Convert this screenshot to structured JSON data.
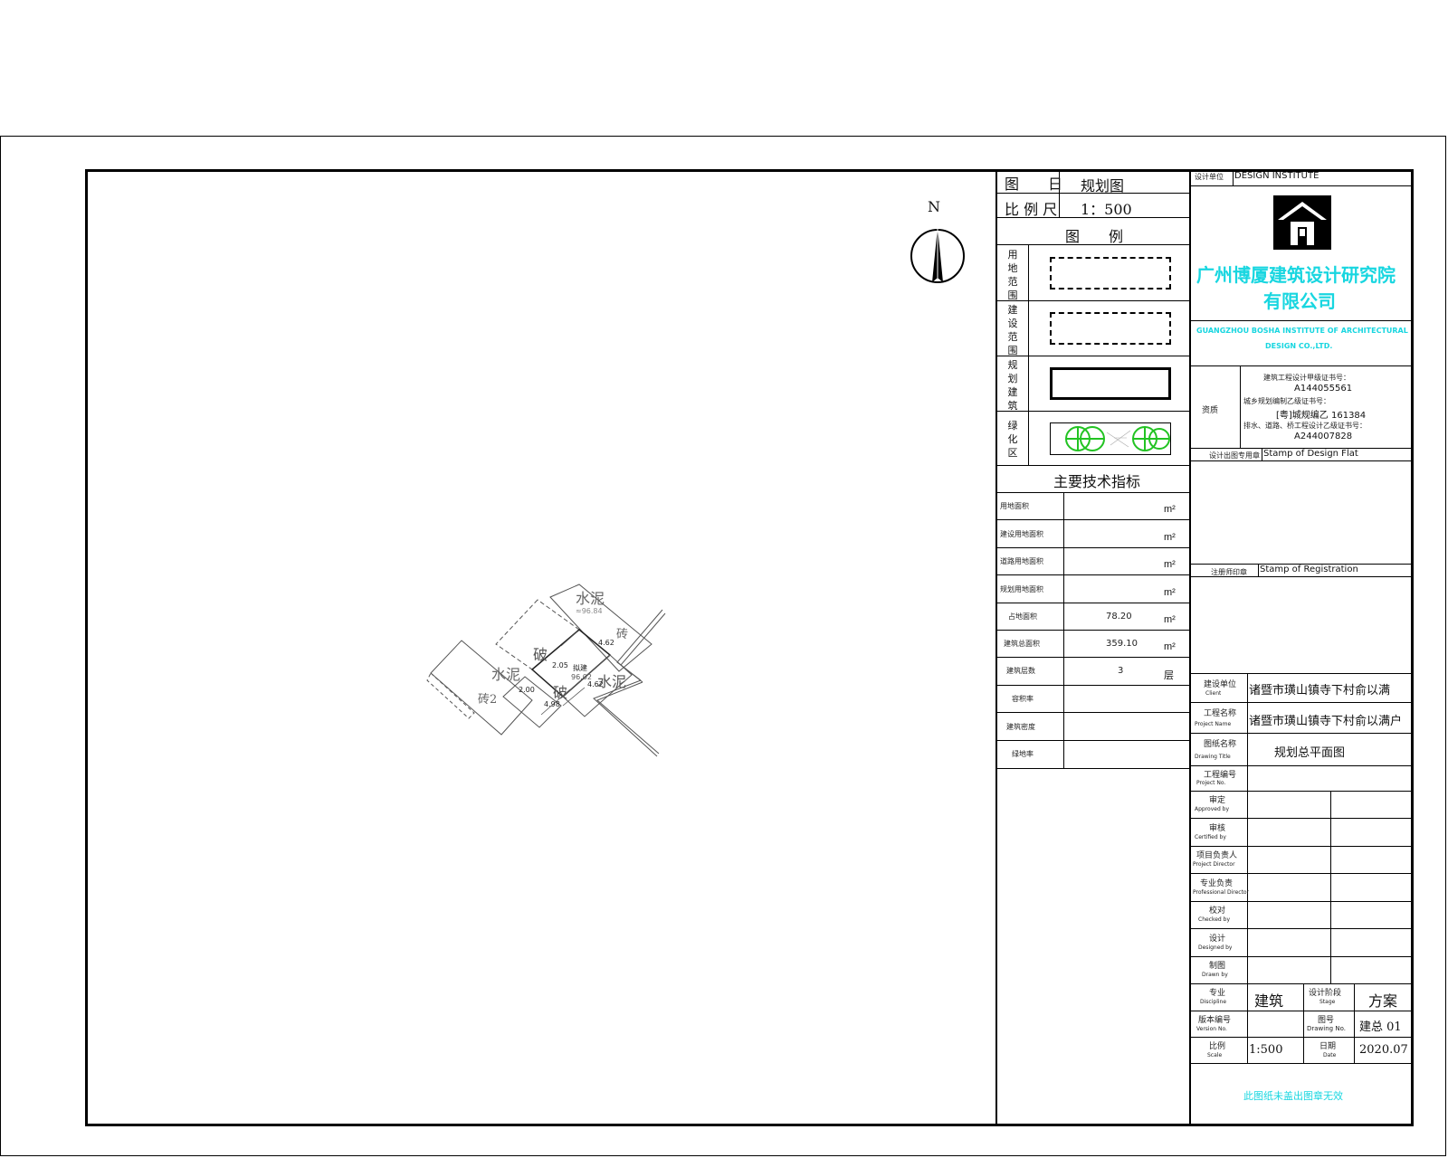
{
  "title_block": {
    "drawing_type_label": "图　　日",
    "drawing_type_value": "规划图",
    "scale_label": "比 例 尺",
    "scale_value": "1：500",
    "legend_title": "图　　例",
    "legend": [
      {
        "label": "用地范围",
        "style": "dash-dot"
      },
      {
        "label": "建设范围",
        "style": "dashed"
      },
      {
        "label": "规划建筑",
        "style": "solid"
      },
      {
        "label": "绿化区",
        "style": "hatch-green"
      }
    ],
    "green_color": "#22c322",
    "indicators_title": "主要技术指标",
    "indicators": [
      {
        "label": "用地面积",
        "value": "",
        "unit": "m²"
      },
      {
        "label": "建设用地面积",
        "value": "",
        "unit": "m²"
      },
      {
        "label": "道路用地面积",
        "value": "",
        "unit": "m²"
      },
      {
        "label": "规划用地面积",
        "value": "",
        "unit": "m²"
      },
      {
        "label": "占地面积",
        "value": "78.20",
        "unit": "m²"
      },
      {
        "label": "建筑总面积",
        "value": "359.10",
        "unit": "m²"
      },
      {
        "label": "建筑层数",
        "value": "3",
        "unit": "层"
      },
      {
        "label": "容积率",
        "value": "",
        "unit": ""
      },
      {
        "label": "建筑密度",
        "value": "",
        "unit": ""
      },
      {
        "label": "绿地率",
        "value": "",
        "unit": ""
      }
    ]
  },
  "institute": {
    "header_label": "设计单位",
    "header_text": "DESIGN INSTITUTE",
    "name_cn_line1": "广州博厦建筑设计研究院",
    "name_cn_line2": "有限公司",
    "name_en_line1": "GUANGZHOU BOSHA INSTITUTE OF ARCHITECTURAL",
    "name_en_line2": "DESIGN  CO.,LTD.",
    "brand_color": "#18d6e0",
    "cert_label": "资质",
    "cert_lines": [
      "建筑工程设计甲级证书号：",
      "A144055561",
      "城乡规划编制乙级证书号：",
      "[粤]城规编乙 161384",
      "排水、道路、桥工程设计乙级证书号：",
      "A244007828"
    ],
    "stamp_design_label": "设计出图专用章",
    "stamp_design_text": "Stamp of Design Flat",
    "stamp_reg_label": "注册师印章",
    "stamp_reg_text": "Stamp of Registration"
  },
  "project": {
    "rows": [
      {
        "label": "建设单位",
        "sub": "Client",
        "value": "诸暨市璜山镇寺下村俞以满"
      },
      {
        "label": "工程名称",
        "sub": "Project Name",
        "value": "诸暨市璜山镇寺下村俞以满户"
      },
      {
        "label": "图纸名称",
        "sub": "Drawing Title",
        "value": "规划总平面图"
      },
      {
        "label": "工程编号",
        "sub": "Project No.",
        "value": ""
      }
    ],
    "signoffs": [
      {
        "label": "审定",
        "sub": "Approved by"
      },
      {
        "label": "审核",
        "sub": "Certified by"
      },
      {
        "label": "项目负责人",
        "sub": "Project Director"
      },
      {
        "label": "专业负责",
        "sub": "Professional Director"
      },
      {
        "label": "校对",
        "sub": "Checked by"
      },
      {
        "label": "设计",
        "sub": "Designed by"
      },
      {
        "label": "制图",
        "sub": "Drawn by"
      }
    ],
    "discipline_label": "专业",
    "discipline_sub": "Discipline",
    "discipline_value": "建筑",
    "stage_label": "设计阶段",
    "stage_sub": "Stage",
    "stage_value": "方案",
    "version_label": "版本编号",
    "version_sub": "Version No.",
    "version_value": "",
    "drawing_no_label": "图号",
    "drawing_no_sub": "Drawing No.",
    "drawing_no_value": "建总 01",
    "scale_label": "比例",
    "scale_sub": "Scale",
    "scale_value": "1:500",
    "date_label": "日期",
    "date_sub": "Date",
    "date_value": "2020.07",
    "footer_note": "此图纸未盖出图章无效"
  },
  "site_plan": {
    "north_label": "N",
    "labels": [
      {
        "text": "水泥"
      },
      {
        "text": "≈96.84"
      },
      {
        "text": "砖"
      },
      {
        "text": "破"
      },
      {
        "text": "水泥"
      },
      {
        "text": "破"
      },
      {
        "text": "水泥"
      },
      {
        "text": "砖2"
      },
      {
        "text": "拟建"
      },
      {
        "text": "96.02"
      }
    ],
    "dims": [
      "4.62",
      "4.62",
      "2.05",
      "4.98",
      "2.00"
    ]
  }
}
